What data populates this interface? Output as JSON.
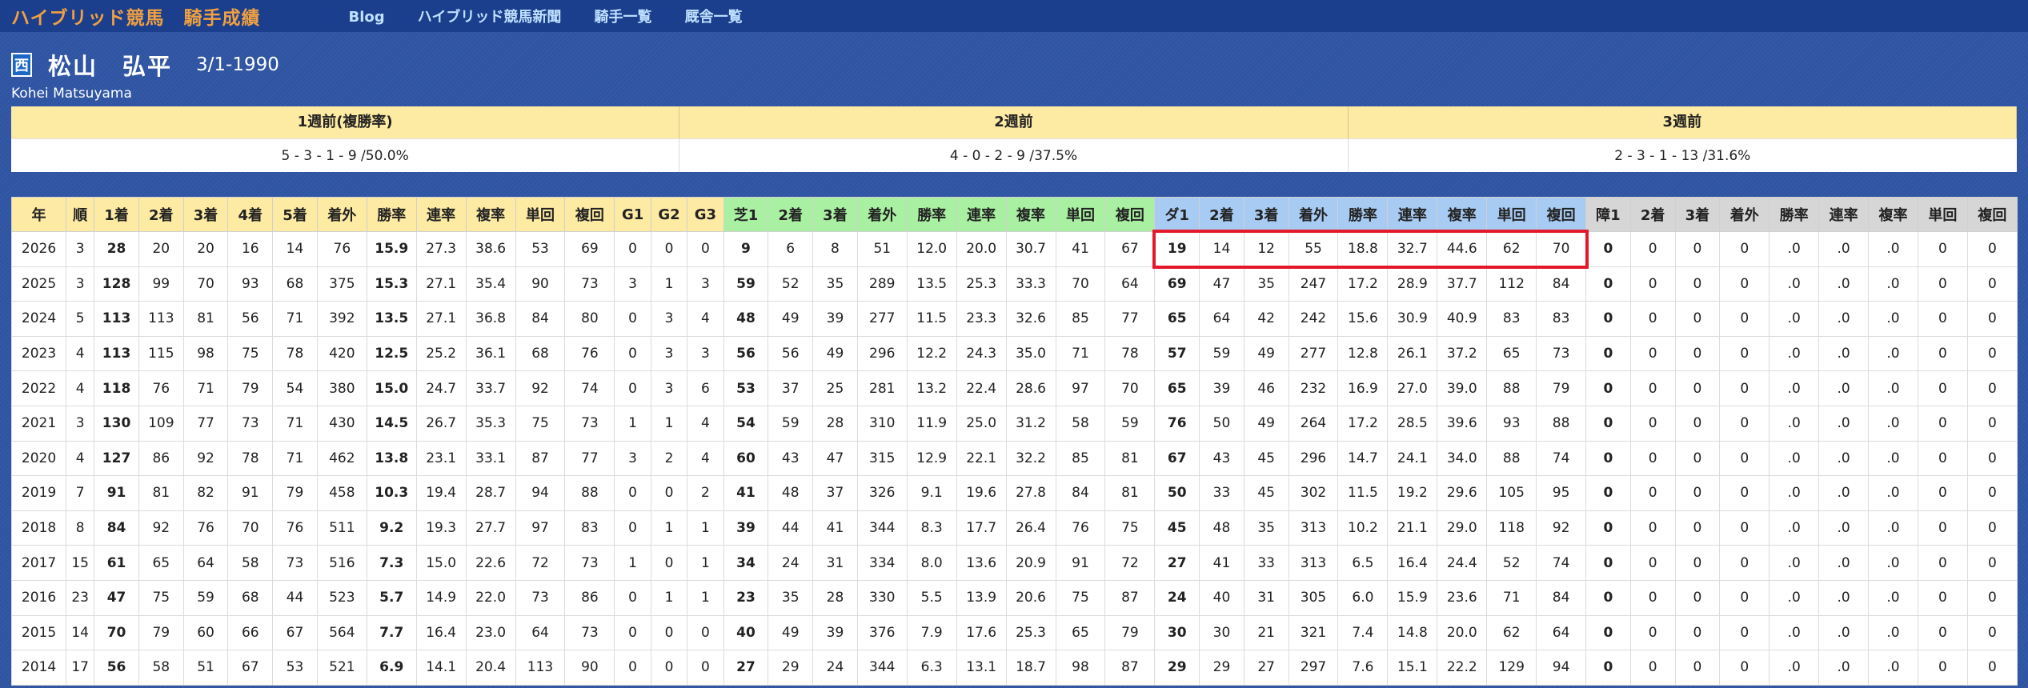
{
  "header": {
    "site_title": "ハイブリッド競馬　騎手成績",
    "nav": [
      "Blog",
      "ハイブリッド競馬新聞",
      "騎手一覧",
      "厩舎一覧"
    ]
  },
  "jockey": {
    "region": "西",
    "name": "松山　弘平",
    "birth": "3/1-1990",
    "romaji": "Kohei Matsuyama"
  },
  "recent": {
    "headers": [
      "1週前(複勝率)",
      "2週前",
      "3週前"
    ],
    "values": [
      "5 - 3 - 1 - 9 /50.0%",
      "4 - 0 - 2 - 9 /37.5%",
      "2 - 3 - 1 - 13 /31.6%"
    ]
  },
  "colors": {
    "all": "#fdeaa3",
    "turf": "#a9f0a2",
    "dirt": "#a8cbf4",
    "obstacle": "#d6d6d6",
    "highlight": "#e3192b"
  },
  "stats": {
    "columns": [
      "年",
      "順",
      "1着",
      "2着",
      "3着",
      "4着",
      "5着",
      "着外",
      "勝率",
      "連率",
      "複率",
      "単回",
      "複回",
      "G1",
      "G2",
      "G3",
      "芝1",
      "2着",
      "3着",
      "着外",
      "勝率",
      "連率",
      "複率",
      "単回",
      "複回",
      "ダ1",
      "2着",
      "3着",
      "着外",
      "勝率",
      "連率",
      "複率",
      "単回",
      "複回",
      "障1",
      "2着",
      "3着",
      "着外",
      "勝率",
      "連率",
      "複率",
      "単回",
      "複回"
    ],
    "rows": [
      [
        "2026",
        "3",
        "28",
        "20",
        "20",
        "16",
        "14",
        "76",
        "15.9",
        "27.3",
        "38.6",
        "53",
        "69",
        "0",
        "0",
        "0",
        "9",
        "6",
        "8",
        "51",
        "12.0",
        "20.0",
        "30.7",
        "41",
        "67",
        "19",
        "14",
        "12",
        "55",
        "18.8",
        "32.7",
        "44.6",
        "62",
        "70",
        "0",
        "0",
        "0",
        "0",
        ".0",
        ".0",
        ".0",
        "0",
        "0"
      ],
      [
        "2025",
        "3",
        "128",
        "99",
        "70",
        "93",
        "68",
        "375",
        "15.3",
        "27.1",
        "35.4",
        "90",
        "73",
        "3",
        "1",
        "3",
        "59",
        "52",
        "35",
        "289",
        "13.5",
        "25.3",
        "33.3",
        "70",
        "64",
        "69",
        "47",
        "35",
        "247",
        "17.2",
        "28.9",
        "37.7",
        "112",
        "84",
        "0",
        "0",
        "0",
        "0",
        ".0",
        ".0",
        ".0",
        "0",
        "0"
      ],
      [
        "2024",
        "5",
        "113",
        "113",
        "81",
        "56",
        "71",
        "392",
        "13.5",
        "27.1",
        "36.8",
        "84",
        "80",
        "0",
        "3",
        "4",
        "48",
        "49",
        "39",
        "277",
        "11.5",
        "23.3",
        "32.6",
        "85",
        "77",
        "65",
        "64",
        "42",
        "242",
        "15.6",
        "30.9",
        "40.9",
        "83",
        "83",
        "0",
        "0",
        "0",
        "0",
        ".0",
        ".0",
        ".0",
        "0",
        "0"
      ],
      [
        "2023",
        "4",
        "113",
        "115",
        "98",
        "75",
        "78",
        "420",
        "12.5",
        "25.2",
        "36.1",
        "68",
        "76",
        "0",
        "3",
        "3",
        "56",
        "56",
        "49",
        "296",
        "12.2",
        "24.3",
        "35.0",
        "71",
        "78",
        "57",
        "59",
        "49",
        "277",
        "12.8",
        "26.1",
        "37.2",
        "65",
        "73",
        "0",
        "0",
        "0",
        "0",
        ".0",
        ".0",
        ".0",
        "0",
        "0"
      ],
      [
        "2022",
        "4",
        "118",
        "76",
        "71",
        "79",
        "54",
        "380",
        "15.0",
        "24.7",
        "33.7",
        "92",
        "74",
        "0",
        "3",
        "6",
        "53",
        "37",
        "25",
        "281",
        "13.2",
        "22.4",
        "28.6",
        "97",
        "70",
        "65",
        "39",
        "46",
        "232",
        "16.9",
        "27.0",
        "39.0",
        "88",
        "79",
        "0",
        "0",
        "0",
        "0",
        ".0",
        ".0",
        ".0",
        "0",
        "0"
      ],
      [
        "2021",
        "3",
        "130",
        "109",
        "77",
        "73",
        "71",
        "430",
        "14.5",
        "26.7",
        "35.3",
        "75",
        "73",
        "1",
        "1",
        "4",
        "54",
        "59",
        "28",
        "310",
        "11.9",
        "25.0",
        "31.2",
        "58",
        "59",
        "76",
        "50",
        "49",
        "264",
        "17.2",
        "28.5",
        "39.6",
        "93",
        "88",
        "0",
        "0",
        "0",
        "0",
        ".0",
        ".0",
        ".0",
        "0",
        "0"
      ],
      [
        "2020",
        "4",
        "127",
        "86",
        "92",
        "78",
        "71",
        "462",
        "13.8",
        "23.1",
        "33.1",
        "87",
        "77",
        "3",
        "2",
        "4",
        "60",
        "43",
        "47",
        "315",
        "12.9",
        "22.1",
        "32.2",
        "85",
        "81",
        "67",
        "43",
        "45",
        "296",
        "14.7",
        "24.1",
        "34.0",
        "88",
        "74",
        "0",
        "0",
        "0",
        "0",
        ".0",
        ".0",
        ".0",
        "0",
        "0"
      ],
      [
        "2019",
        "7",
        "91",
        "81",
        "82",
        "91",
        "79",
        "458",
        "10.3",
        "19.4",
        "28.7",
        "94",
        "88",
        "0",
        "0",
        "2",
        "41",
        "48",
        "37",
        "326",
        "9.1",
        "19.6",
        "27.8",
        "84",
        "81",
        "50",
        "33",
        "45",
        "302",
        "11.5",
        "19.2",
        "29.6",
        "105",
        "95",
        "0",
        "0",
        "0",
        "0",
        ".0",
        ".0",
        ".0",
        "0",
        "0"
      ],
      [
        "2018",
        "8",
        "84",
        "92",
        "76",
        "70",
        "76",
        "511",
        "9.2",
        "19.3",
        "27.7",
        "97",
        "83",
        "0",
        "1",
        "1",
        "39",
        "44",
        "41",
        "344",
        "8.3",
        "17.7",
        "26.4",
        "76",
        "75",
        "45",
        "48",
        "35",
        "313",
        "10.2",
        "21.1",
        "29.0",
        "118",
        "92",
        "0",
        "0",
        "0",
        "0",
        ".0",
        ".0",
        ".0",
        "0",
        "0"
      ],
      [
        "2017",
        "15",
        "61",
        "65",
        "64",
        "58",
        "73",
        "516",
        "7.3",
        "15.0",
        "22.6",
        "72",
        "73",
        "1",
        "0",
        "1",
        "34",
        "24",
        "31",
        "334",
        "8.0",
        "13.6",
        "20.9",
        "91",
        "72",
        "27",
        "41",
        "33",
        "313",
        "6.5",
        "16.4",
        "24.4",
        "52",
        "74",
        "0",
        "0",
        "0",
        "0",
        ".0",
        ".0",
        ".0",
        "0",
        "0"
      ],
      [
        "2016",
        "23",
        "47",
        "75",
        "59",
        "68",
        "44",
        "523",
        "5.7",
        "14.9",
        "22.0",
        "73",
        "86",
        "0",
        "1",
        "1",
        "23",
        "35",
        "28",
        "330",
        "5.5",
        "13.9",
        "20.6",
        "75",
        "87",
        "24",
        "40",
        "31",
        "305",
        "6.0",
        "15.9",
        "23.6",
        "71",
        "84",
        "0",
        "0",
        "0",
        "0",
        ".0",
        ".0",
        ".0",
        "0",
        "0"
      ],
      [
        "2015",
        "14",
        "70",
        "79",
        "60",
        "66",
        "67",
        "564",
        "7.7",
        "16.4",
        "23.0",
        "64",
        "73",
        "0",
        "0",
        "0",
        "40",
        "49",
        "39",
        "376",
        "7.9",
        "17.6",
        "25.3",
        "65",
        "79",
        "30",
        "30",
        "21",
        "321",
        "7.4",
        "14.8",
        "20.0",
        "62",
        "64",
        "0",
        "0",
        "0",
        "0",
        ".0",
        ".0",
        ".0",
        "0",
        "0"
      ],
      [
        "2014",
        "17",
        "56",
        "58",
        "51",
        "67",
        "53",
        "521",
        "6.9",
        "14.1",
        "20.4",
        "113",
        "90",
        "0",
        "0",
        "0",
        "27",
        "29",
        "24",
        "344",
        "6.3",
        "13.1",
        "18.7",
        "98",
        "87",
        "29",
        "29",
        "27",
        "297",
        "7.6",
        "15.1",
        "22.2",
        "129",
        "94",
        "0",
        "0",
        "0",
        "0",
        ".0",
        ".0",
        ".0",
        "0",
        "0"
      ]
    ]
  }
}
